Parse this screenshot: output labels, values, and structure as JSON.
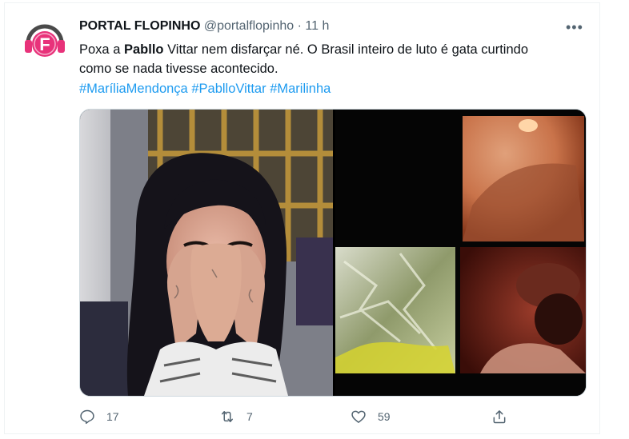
{
  "tweet": {
    "author_name": "PORTAL FLOPINHO",
    "handle": "@portalflopinho",
    "separator": "·",
    "time": "11 h",
    "more_label": "•••",
    "text_part1": "Poxa  a ",
    "text_bold": "Pabllo",
    "text_part2": " Vittar nem disfarçar né. O Brasil inteiro de luto  é gata curtindo como se nada tivesse acontecido.",
    "hashtags": [
      "#MaríliaMendonça",
      "#PablloVittar",
      "#Marilinha"
    ],
    "avatar_letter": "F",
    "icons": {
      "avatar": "headphones-logo-icon",
      "reply": "reply-icon",
      "retweet": "retweet-icon",
      "like": "heart-icon",
      "share": "share-icon"
    },
    "colors": {
      "accent": "#1d9bf0",
      "avatar_pink": "#e8327a",
      "muted": "#536471"
    },
    "stats": {
      "replies": "17",
      "retweets": "7",
      "likes": "59"
    }
  }
}
